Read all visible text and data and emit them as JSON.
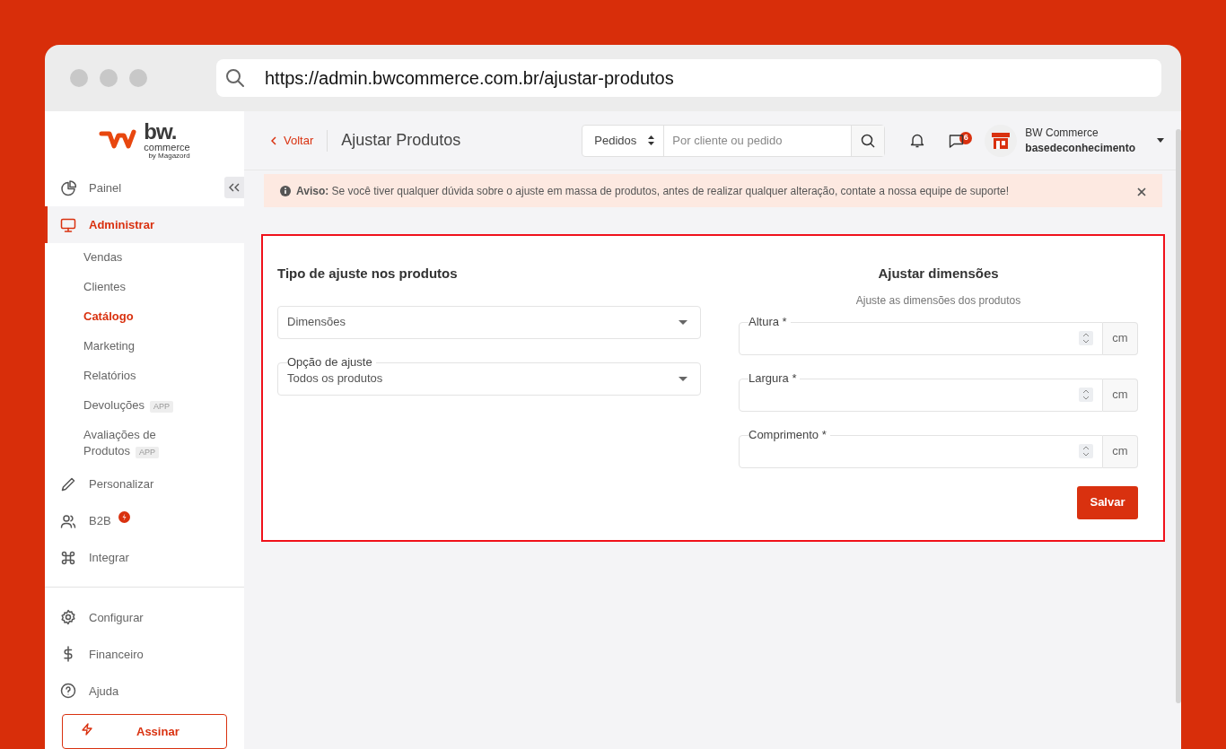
{
  "browser": {
    "url": "https://admin.bwcommerce.com.br/ajustar-produtos"
  },
  "sidebar": {
    "logo": {
      "name": "bw.",
      "line": "commerce",
      "by": "by Magazord"
    },
    "items": [
      {
        "label": "Painel",
        "selected": false
      },
      {
        "label": "Administrar",
        "selected": true,
        "children": [
          {
            "label": "Vendas",
            "selected": false
          },
          {
            "label": "Clientes",
            "selected": false
          },
          {
            "label": "Catálogo",
            "selected": true
          },
          {
            "label": "Marketing",
            "selected": false
          },
          {
            "label": "Relatórios",
            "selected": false
          },
          {
            "label": "Devoluções",
            "selected": false,
            "badge": "APP"
          },
          {
            "label": "Avaliações de Produtos",
            "selected": false,
            "badge": "APP"
          }
        ]
      },
      {
        "label": "Personalizar",
        "selected": false
      },
      {
        "label": "B2B",
        "selected": false,
        "new": true
      },
      {
        "label": "Integrar",
        "selected": false
      }
    ],
    "bottom_items": [
      {
        "label": "Configurar",
        "selected": false
      },
      {
        "label": "Financeiro",
        "selected": false
      },
      {
        "label": "Ajuda",
        "selected": false
      }
    ],
    "cta": "Assinar"
  },
  "header": {
    "back": "Voltar",
    "title": "Ajustar Produtos",
    "search": {
      "scope": "Pedidos",
      "placeholder": "Por cliente ou pedido"
    },
    "messages_count": "6",
    "account": {
      "name": "BW Commerce",
      "user": "basedeconhecimento"
    }
  },
  "alert": {
    "text": "**Aviso:** Se você tiver qualquer dúvida sobre o ajuste em massa de produtos, antes de realizar qualquer alteração, contate a nossa equipe de suporte!"
  },
  "form": {
    "left": {
      "title": "Tipo de ajuste nos produtos",
      "type_select": {
        "value": "Dimensões"
      },
      "option_select": {
        "label": "Opção de ajuste",
        "value": "Todos os produtos"
      }
    },
    "right": {
      "title": "Ajustar dimensões",
      "subtitle": "Ajuste as dimensões dos produtos",
      "fields": [
        {
          "label": "Altura *",
          "unit": "cm"
        },
        {
          "label": "Largura *",
          "unit": "cm"
        },
        {
          "label": "Comprimento *",
          "unit": "cm"
        }
      ],
      "submit": "Salvar"
    }
  }
}
